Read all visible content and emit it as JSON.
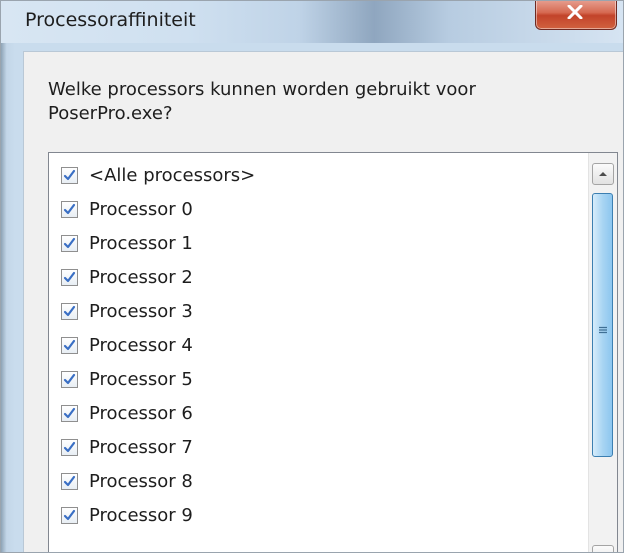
{
  "window": {
    "title": "Processoraffiniteit",
    "close_icon": "close-icon"
  },
  "dialog": {
    "question": "Welke processors kunnen worden gebruikt voor PoserPro.exe?",
    "items": [
      {
        "label": "<Alle processors>",
        "checked": true
      },
      {
        "label": "Processor 0",
        "checked": true
      },
      {
        "label": "Processor 1",
        "checked": true
      },
      {
        "label": "Processor 2",
        "checked": true
      },
      {
        "label": "Processor 3",
        "checked": true
      },
      {
        "label": "Processor 4",
        "checked": true
      },
      {
        "label": "Processor 5",
        "checked": true
      },
      {
        "label": "Processor 6",
        "checked": true
      },
      {
        "label": "Processor 7",
        "checked": true
      },
      {
        "label": "Processor 8",
        "checked": true
      },
      {
        "label": "Processor 9",
        "checked": true
      }
    ]
  },
  "colors": {
    "accent": "#3c7fb1",
    "close_button": "#c2432a",
    "check": "#3a6fc4"
  }
}
